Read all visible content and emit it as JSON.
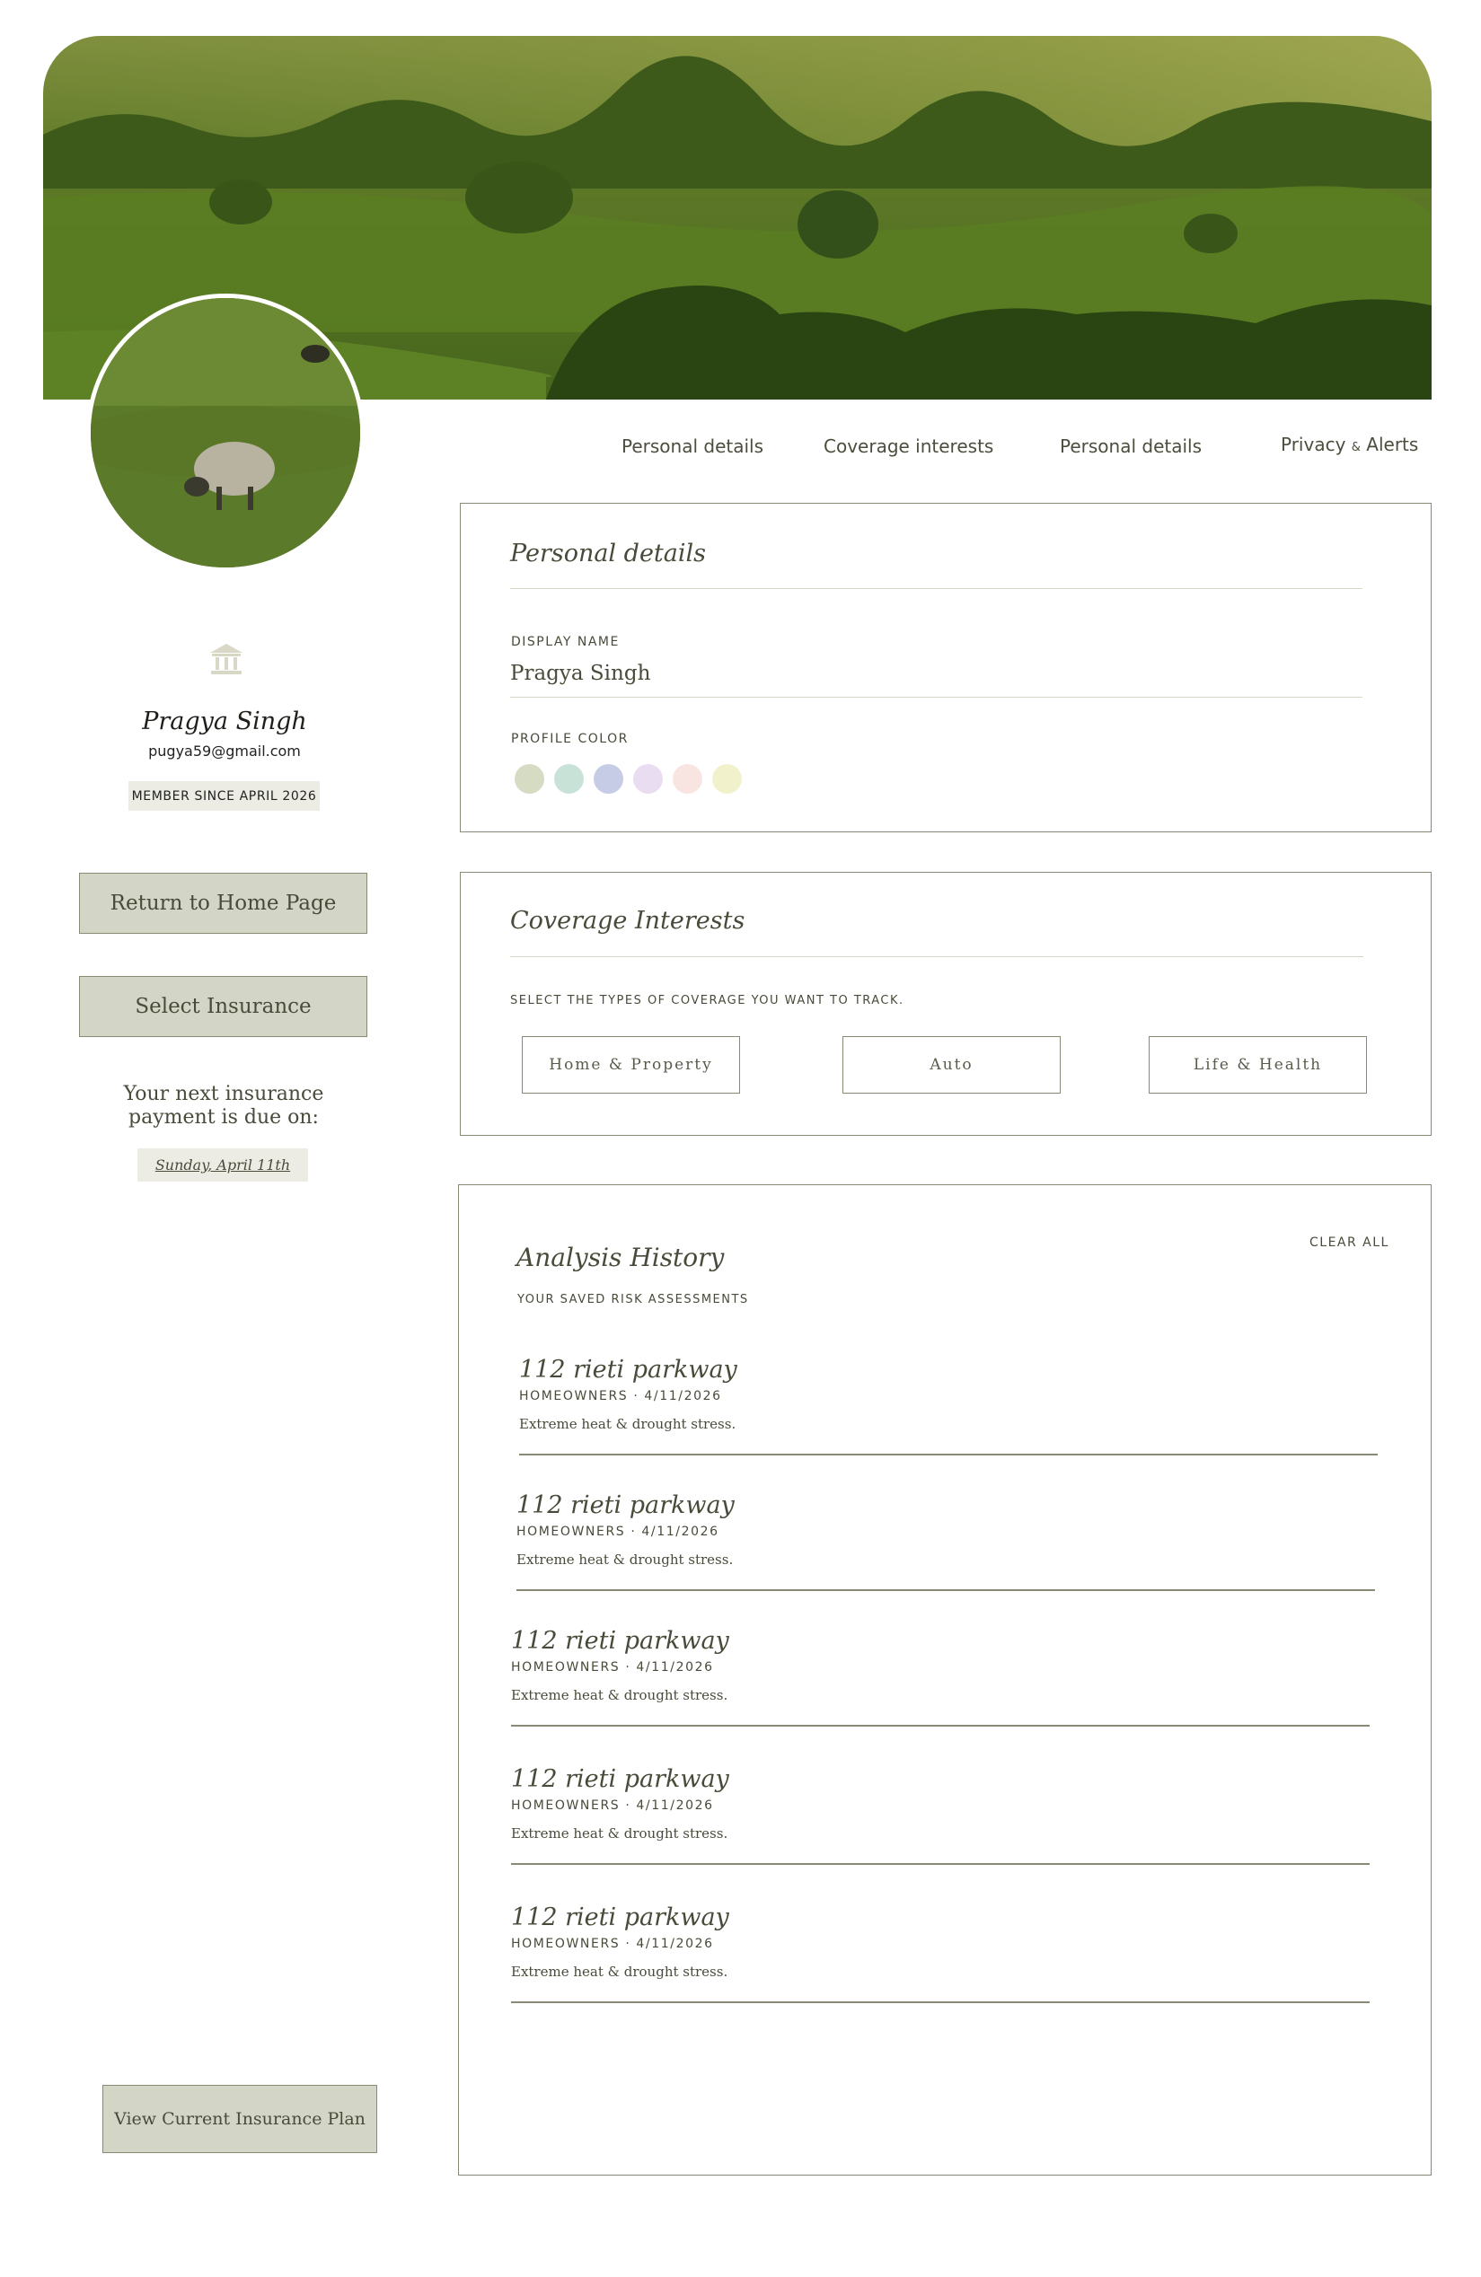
{
  "colors": {
    "accent_bg": "#d3d6c6",
    "border": "#8a8a74",
    "text": "#4a4a3a",
    "badge_bg": "#ecece4"
  },
  "nav": {
    "items": [
      {
        "label": "Personal details"
      },
      {
        "label": "Coverage interests"
      },
      {
        "label": "Personal details"
      },
      {
        "label": "Privacy",
        "amp": "&",
        "label_end": "Alerts"
      }
    ]
  },
  "profile": {
    "icon": "bank-icon",
    "name": "Pragya Singh",
    "email": "pugya59@gmail.com",
    "member_since": "MEMBER SINCE APRIL 2026"
  },
  "sidebar": {
    "return_home": "Return to Home Page",
    "select_insurance": "Select Insurance",
    "payment_line1": "Your next insurance",
    "payment_line2": "payment is due on:",
    "payment_date": "Sunday, April 11th",
    "view_plan": "View Current Insurance Plan"
  },
  "personal_details": {
    "title": "Personal details",
    "display_name_label": "DISPLAY NAME",
    "display_name_value": "Pragya Singh",
    "profile_color_label": "PROFILE COLOR",
    "swatches": [
      "#d6dcc4",
      "#c9e2d8",
      "#c6cbe6",
      "#e9ddf2",
      "#f8e5e2",
      "#f1f2cc"
    ]
  },
  "coverage": {
    "title": "Coverage Interests",
    "subtitle": "SELECT THE TYPES OF COVERAGE YOU WANT TO TRACK.",
    "options": [
      "Home & Property",
      "Auto",
      "Life & Health"
    ]
  },
  "history": {
    "title": "Analysis History",
    "subtitle": "YOUR SAVED RISK ASSESSMENTS",
    "clear_all": "CLEAR ALL",
    "entries": [
      {
        "address": "112 rieti parkway",
        "meta": "HOMEOWNERS · 4/11/2026",
        "note": "Extreme heat & drought stress."
      },
      {
        "address": "112 rieti parkway",
        "meta": "HOMEOWNERS · 4/11/2026",
        "note": "Extreme heat & drought stress."
      },
      {
        "address": "112 rieti parkway",
        "meta": "HOMEOWNERS · 4/11/2026",
        "note": "Extreme heat & drought stress."
      },
      {
        "address": "112 rieti parkway",
        "meta": "HOMEOWNERS · 4/11/2026",
        "note": "Extreme heat & drought stress."
      },
      {
        "address": "112 rieti parkway",
        "meta": "HOMEOWNERS · 4/11/2026",
        "note": "Extreme heat & drought stress."
      }
    ]
  }
}
